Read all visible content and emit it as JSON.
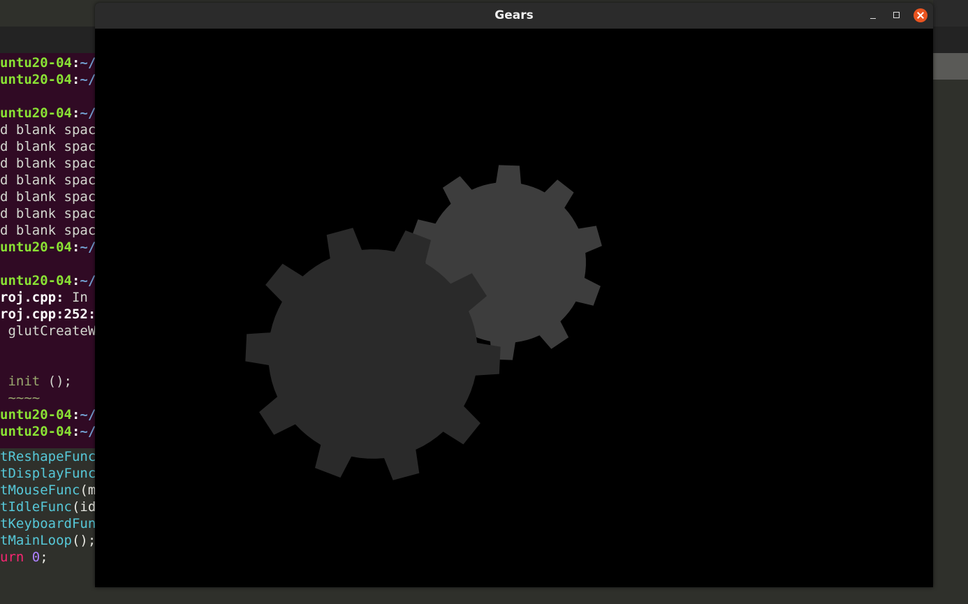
{
  "terminal": {
    "lines": [
      {
        "host": "untu20-04",
        "sep": ":",
        "path": "~/"
      },
      {
        "host": "untu20-04",
        "sep": ":",
        "path": "~/"
      },
      {
        "text": ""
      },
      {
        "host": "untu20-04",
        "sep": ":",
        "path": "~/"
      },
      {
        "text": "d blank spac"
      },
      {
        "text": "d blank spac"
      },
      {
        "text": "d blank spac"
      },
      {
        "text": "d blank spac"
      },
      {
        "text": "d blank spac"
      },
      {
        "text": "d blank spac"
      },
      {
        "text": "d blank spac"
      },
      {
        "host": "untu20-04",
        "sep": ":",
        "path": "~/"
      },
      {
        "text": ""
      },
      {
        "host": "untu20-04",
        "sep": ":",
        "path": "~/"
      },
      {
        "bold": "roj.cpp:",
        "rest": " In"
      },
      {
        "bold": "roj.cpp:252:"
      },
      {
        "text": " glutCreateW"
      },
      {
        "text": ""
      },
      {
        "text": ""
      },
      {
        "olive": " init",
        "rest": " ();"
      },
      {
        "olive": " ~~~~"
      },
      {
        "host": "untu20-04",
        "sep": ":",
        "path": "~/"
      },
      {
        "host": "untu20-04",
        "sep": ":",
        "path": "~/"
      }
    ]
  },
  "editor": {
    "lines": [
      {
        "fn": "tReshapeFunc"
      },
      {
        "fn": "tDisplayFunc"
      },
      {
        "fn": "tMouseFunc",
        "rest": "(m"
      },
      {
        "fn": "tIdleFunc",
        "rest": "(id"
      },
      {
        "fn": "tKeyboardFun"
      },
      {
        "fn": "tMainLoop",
        "rest": "();"
      },
      {
        "kw": "urn",
        "num": "0",
        "rest": ";"
      }
    ]
  },
  "window": {
    "title": "Gears",
    "buttons": {
      "minimize": "minimize",
      "maximize": "maximize",
      "close": "close"
    },
    "icons": [
      "minimize-icon",
      "maximize-icon",
      "close-icon"
    ]
  },
  "colors": {
    "terminal_bg": "#300a24",
    "gear_large": "#2a2a2a",
    "gear_small": "#3d3d3d",
    "close_button": "#e95420"
  }
}
